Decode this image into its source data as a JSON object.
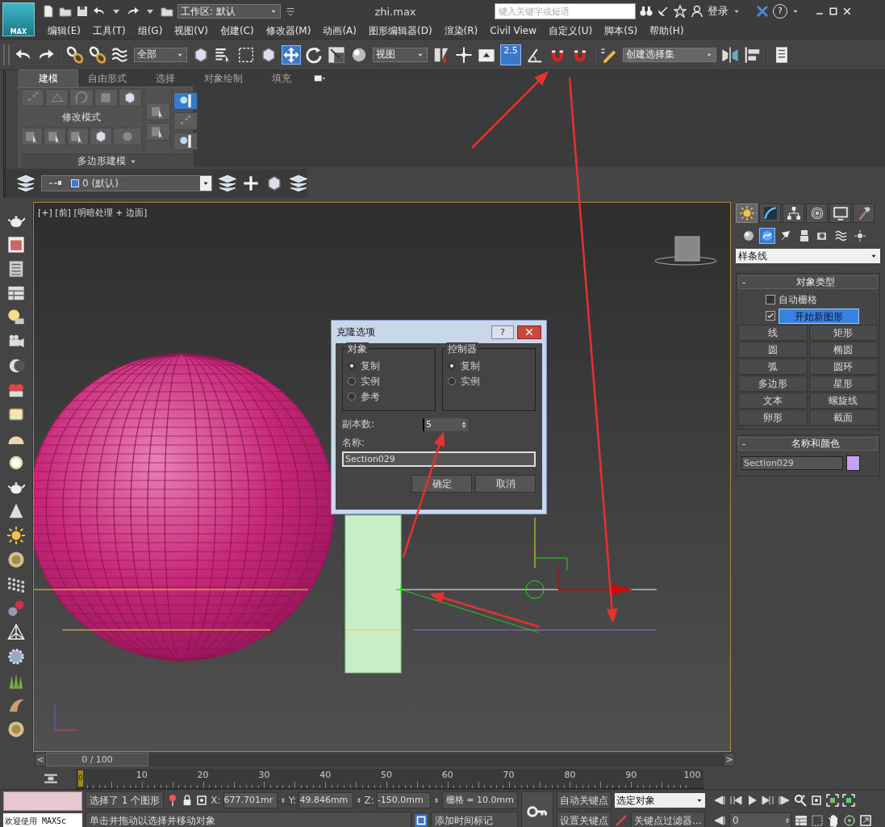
{
  "title_bar": {
    "logo_text": "MAX",
    "workspace": "工作区: 默认",
    "title": "zhi.max",
    "search": {
      "placeholder": "键入关键字或短语"
    },
    "login": "登录",
    "help": "?"
  },
  "menu": [
    "编辑(E)",
    "工具(T)",
    "组(G)",
    "视图(V)",
    "创建(C)",
    "修改器(M)",
    "动画(A)",
    "图形编辑器(D)",
    "渲染(R)",
    "Civil View",
    "自定义(U)",
    "脚本(S)",
    "帮助(H)"
  ],
  "main_toolbar": {
    "selection_filter": "全部",
    "transform_tools": [
      {
        "selected": true
      },
      {
        "selected": false
      },
      {
        "selected": false
      }
    ],
    "coordinate_system": "视图",
    "snap_toggle": {
      "label": "2.5",
      "selected": true
    },
    "named_selection": "创建选择集"
  },
  "ribbon": {
    "tabs": [
      {
        "label": "建模",
        "selected": true
      },
      {
        "label": "自由形式",
        "selected": false
      },
      {
        "label": "选择",
        "selected": false
      },
      {
        "label": "对象绘制",
        "selected": false
      },
      {
        "label": "填充",
        "selected": false
      }
    ],
    "panel_label": "修改模式",
    "panel_title": "多边形建模"
  },
  "layer_toolbar": {
    "layer": "0 (默认)"
  },
  "viewport": {
    "label": "[+] [前] [明暗处理 + 边面]"
  },
  "clone_dialog": {
    "title": "克隆选项",
    "help": "?",
    "groups": [
      {
        "title": "对象",
        "options": [
          {
            "label": "复制",
            "selected": true
          },
          {
            "label": "实例",
            "selected": false
          },
          {
            "label": "参考",
            "selected": false
          }
        ]
      },
      {
        "title": "控制器",
        "options": [
          {
            "label": "复制",
            "selected": true
          },
          {
            "label": "实例",
            "selected": false
          }
        ]
      }
    ],
    "copies_label": "副本数:",
    "copies": "5",
    "name_label": "名称:",
    "name": "Section029",
    "buttons": [
      "确定",
      "取消"
    ]
  },
  "command_panel": {
    "tabs": [
      {
        "selected": true
      },
      {
        "selected": false
      },
      {
        "selected": false
      },
      {
        "selected": false
      },
      {
        "selected": false
      },
      {
        "selected": false
      }
    ],
    "categories": [
      {
        "selected": false
      },
      {
        "selected": true
      },
      {
        "selected": false
      },
      {
        "selected": false
      },
      {
        "selected": false
      },
      {
        "selected": false
      },
      {
        "selected": false
      }
    ],
    "subcategory": "样条线",
    "object_type": {
      "toggle": "-",
      "title": "对象类型",
      "auto_grid": {
        "label": "自动栅格",
        "checked": false
      },
      "start_new_shape": {
        "label": "开始新图形",
        "checked": true
      },
      "buttons": [
        "线",
        "矩形",
        "圆",
        "椭圆",
        "弧",
        "圆环",
        "多边形",
        "星形",
        "文本",
        "螺旋线",
        "卵形",
        "截面"
      ]
    },
    "name_and_color": {
      "toggle": "-",
      "title": "名称和颜色",
      "name": "Section029",
      "color": "#c8a2f2"
    }
  },
  "time_slider": {
    "prev": "<",
    "position": "0 / 100",
    "next": ">"
  },
  "track_bar": {
    "current": "0",
    "ticks": [
      "10",
      "20",
      "30",
      "40",
      "50",
      "60",
      "70",
      "80",
      "90",
      "100"
    ]
  },
  "status_bar": {
    "script_output": "欢迎使用 MAXSc",
    "selection": "选择了 1 个图形",
    "x_label": "X:",
    "x": "677.701mr",
    "y_label": "Y:",
    "y": "49.846mm",
    "z_label": "Z:",
    "z": "-150.0mm",
    "grid": "栅格 = 10.0mm",
    "prompt": "单击并拖动以选择并移动对象",
    "add_time_tag": "添加时间标记",
    "auto_key": "自动关键点",
    "key_mode": "选定对象",
    "set_key": "设置关键点",
    "key_filters": "关键点过滤器...",
    "frame": "0"
  }
}
